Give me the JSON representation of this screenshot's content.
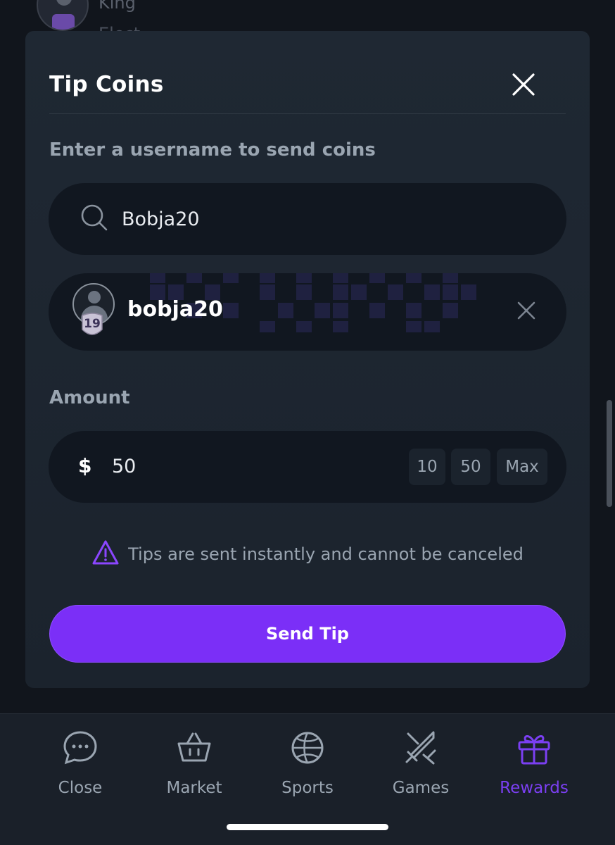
{
  "background": {
    "name": "King",
    "sub": "Elect..."
  },
  "modal": {
    "title": "Tip Coins",
    "close_icon": "close-icon",
    "username_label": "Enter a username to send coins",
    "search": {
      "value": "Bobja20",
      "icon": "search-icon"
    },
    "selected_user": {
      "name": "bobja20",
      "level": "19",
      "remove_icon": "close-icon"
    },
    "amount_label": "Amount",
    "amount": {
      "currency": "$",
      "value": "50",
      "quick_options": [
        "10",
        "50",
        "Max"
      ]
    },
    "warning": {
      "icon": "warning-triangle-icon",
      "text": "Tips are sent instantly and cannot be canceled"
    },
    "send_label": "Send Tip"
  },
  "bottom_nav": {
    "items": [
      {
        "label": "Close",
        "icon": "chat-bubble-icon",
        "active": false
      },
      {
        "label": "Market",
        "icon": "basket-icon",
        "active": false
      },
      {
        "label": "Sports",
        "icon": "basketball-icon",
        "active": false
      },
      {
        "label": "Games",
        "icon": "crossed-swords-icon",
        "active": false
      },
      {
        "label": "Rewards",
        "icon": "gift-icon",
        "active": true
      }
    ]
  },
  "colors": {
    "accent": "#7b2ff7",
    "active_nav": "#7b3ff2",
    "warning": "#8b46ff",
    "modal_bg": "#1f2833",
    "field_bg": "#111720"
  }
}
